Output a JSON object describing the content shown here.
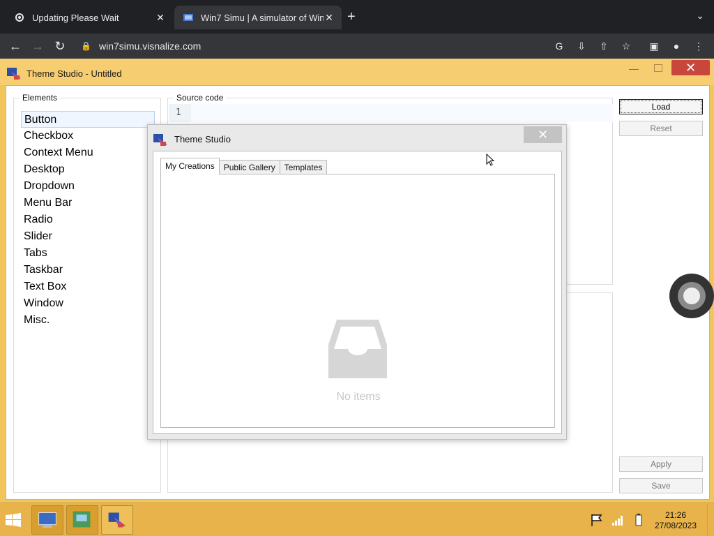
{
  "browser": {
    "tabs": [
      {
        "title": "Updating Please Wait",
        "icon": "gear-icon"
      },
      {
        "title": "Win7 Simu | A simulator of Win",
        "icon": "windows-icon"
      }
    ],
    "url": "win7simu.visnalize.com"
  },
  "app": {
    "title": "Theme Studio - Untitled",
    "elements_legend": "Elements",
    "elements": [
      "Button",
      "Checkbox",
      "Context Menu",
      "Desktop",
      "Dropdown",
      "Menu Bar",
      "Radio",
      "Slider",
      "Tabs",
      "Taskbar",
      "Text Box",
      "Window",
      "Misc."
    ],
    "source_legend": "Source code",
    "line_number": "1",
    "buttons": {
      "load": "Load",
      "reset": "Reset",
      "apply": "Apply",
      "save": "Save"
    }
  },
  "dialog": {
    "title": "Theme Studio",
    "tabs": [
      "My Creations",
      "Public Gallery",
      "Templates"
    ],
    "empty_text": "No items"
  },
  "taskbar": {
    "time": "21:26",
    "date": "27/08/2023"
  },
  "colors": {
    "accent": "#f2c55c",
    "close_red": "#c9463d"
  }
}
